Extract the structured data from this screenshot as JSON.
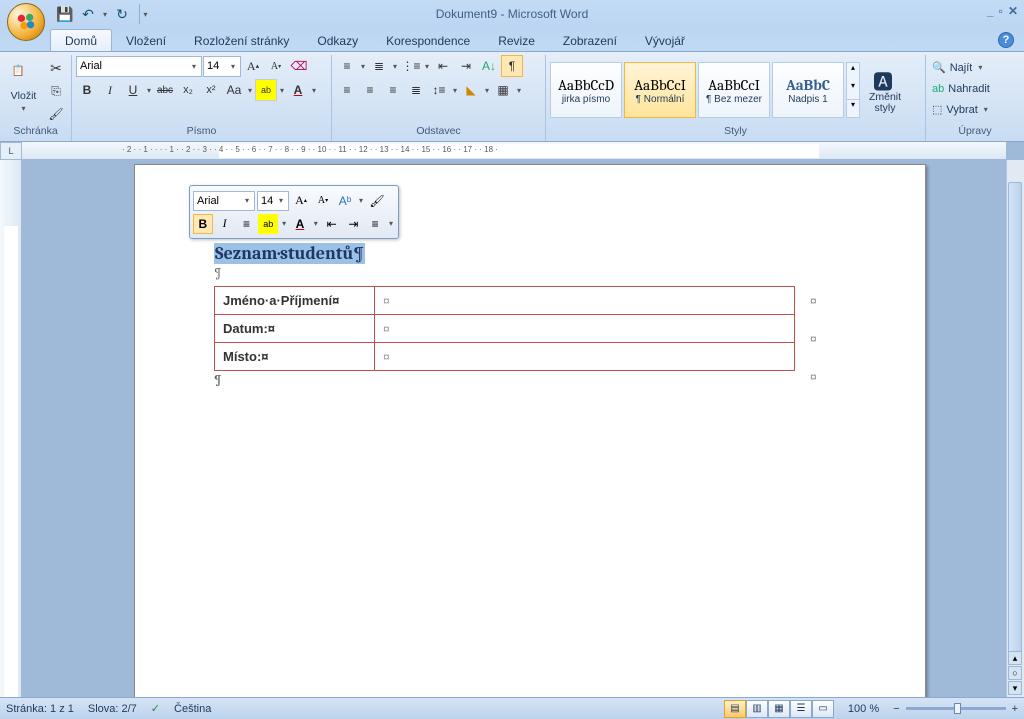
{
  "title": "Dokument9 - Microsoft Word",
  "tabs": [
    "Domů",
    "Vložení",
    "Rozložení stránky",
    "Odkazy",
    "Korespondence",
    "Revize",
    "Zobrazení",
    "Vývojář"
  ],
  "active_tab": 0,
  "ribbon": {
    "clipboard": {
      "paste": "Vložit",
      "label": "Schránka"
    },
    "font": {
      "name": "Arial",
      "size": "14",
      "label": "Písmo",
      "bold": "B",
      "italic": "I",
      "underline": "U",
      "strike": "abc",
      "sub": "x₂",
      "sup": "x²",
      "case": "Aa"
    },
    "paragraph": {
      "label": "Odstavec"
    },
    "styles": {
      "label": "Styly",
      "items": [
        {
          "preview": "AaBbCcD",
          "name": "jirka písmo"
        },
        {
          "preview": "AaBbCcI",
          "name": "¶ Normální"
        },
        {
          "preview": "AaBbCcI",
          "name": "¶ Bez mezer"
        },
        {
          "preview": "AaBbC",
          "name": "Nadpis 1"
        }
      ],
      "change": "Změnit\nstyly"
    },
    "editing": {
      "label": "Úpravy",
      "find": "Najít",
      "replace": "Nahradit",
      "select": "Vybrat"
    }
  },
  "minitb": {
    "font": "Arial",
    "size": "14"
  },
  "document": {
    "heading": "Seznam·studentů",
    "rows": [
      {
        "label": "Jméno·a·Příjmení¤",
        "value": "¤"
      },
      {
        "label": "Datum:¤",
        "value": "¤"
      },
      {
        "label": "Místo:¤",
        "value": "¤"
      }
    ]
  },
  "ruler": "   · 2 ·   · 1 ·   ·   ·   · 1 ·   · 2 ·   · 3 ·   · 4 ·   · 5 ·   · 6 ·   · 7 ·   · 8 ·   · 9 ·   · 10 ·   · 11 ·   · 12 ·   · 13 ·   · 14 ·   · 15 ·   · 16 ·   · 17 ·   · 18 · ",
  "status": {
    "page": "Stránka: 1 z 1",
    "words": "Slova: 2/7",
    "lang": "Čeština",
    "zoom": "100 %"
  }
}
